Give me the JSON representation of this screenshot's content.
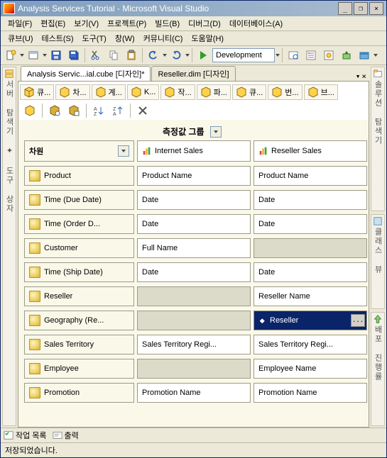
{
  "window": {
    "title": "Analysis Services Tutorial - Microsoft Visual Studio"
  },
  "menu": {
    "file": "파일(F)",
    "edit": "편집(E)",
    "view": "보기(V)",
    "project": "프로젝트(P)",
    "build": "빌드(B)",
    "debug": "디버그(D)",
    "database": "데이터베이스(A)",
    "cube": "큐브(U)",
    "test": "테스트(S)",
    "tools": "도구(T)",
    "window_menu": "창(W)",
    "community": "커뮤니티(C)",
    "help": "도움말(H)"
  },
  "toolbar": {
    "config": "Development"
  },
  "tabs": {
    "doc": [
      "Analysis Servic...ial.cube [디자인]*",
      "Reseller.dim [디자인]"
    ],
    "designer": [
      "큐...",
      "차...",
      "계...",
      "K...",
      "작...",
      "파...",
      "큐...",
      "번...",
      "브..."
    ]
  },
  "rails": {
    "left": "서버 탐색기 ✦ 도구 상자",
    "right1": "솔루션 탐색기",
    "right2": "클래스 뷰",
    "right3": "배포 진행률"
  },
  "grid": {
    "measure_groups_label": "측정값 그룹",
    "dimensions_label": "차원",
    "measures": [
      "Internet Sales",
      "Reseller Sales"
    ],
    "rows": [
      {
        "dim": "Product",
        "c1": {
          "v": "Product Name"
        },
        "c2": {
          "v": "Product Name"
        }
      },
      {
        "dim": "Time (Due Date)",
        "c1": {
          "v": "Date"
        },
        "c2": {
          "v": "Date"
        }
      },
      {
        "dim": "Time (Order D...",
        "c1": {
          "v": "Date"
        },
        "c2": {
          "v": "Date"
        }
      },
      {
        "dim": "Customer",
        "c1": {
          "v": "Full Name"
        },
        "c2": {
          "disabled": true
        }
      },
      {
        "dim": "Time (Ship Date)",
        "c1": {
          "v": "Date"
        },
        "c2": {
          "v": "Date"
        }
      },
      {
        "dim": "Reseller",
        "c1": {
          "disabled": true
        },
        "c2": {
          "v": "Reseller Name"
        }
      },
      {
        "dim": "Geography (Re...",
        "c1": {
          "disabled": true
        },
        "c2": {
          "v": "Reseller",
          "selected": true
        }
      },
      {
        "dim": "Sales Territory",
        "c1": {
          "v": "Sales Territory Regi..."
        },
        "c2": {
          "v": "Sales Territory Regi..."
        }
      },
      {
        "dim": "Employee",
        "c1": {
          "disabled": true
        },
        "c2": {
          "v": "Employee Name"
        }
      },
      {
        "dim": "Promotion",
        "c1": {
          "v": "Promotion Name"
        },
        "c2": {
          "v": "Promotion Name"
        }
      }
    ]
  },
  "bottom": {
    "tasklist": "작업 목록",
    "output": "출력"
  },
  "status": {
    "text": "저장되었습니다."
  }
}
